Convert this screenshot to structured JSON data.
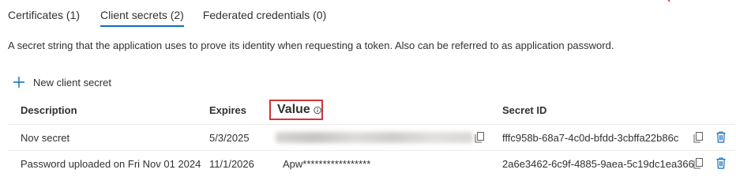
{
  "tabs": [
    {
      "label": "Certificates (1)",
      "active": false
    },
    {
      "label": "Client secrets (2)",
      "active": true
    },
    {
      "label": "Federated credentials (0)",
      "active": false
    }
  ],
  "description": "A secret string that the application uses to prove its identity when requesting a token. Also can be referred to as application password.",
  "new_secret_label": "New client secret",
  "table": {
    "headers": {
      "description": "Description",
      "expires": "Expires",
      "value": "Value",
      "secret_id": "Secret ID"
    },
    "rows": [
      {
        "description": "Nov secret",
        "expires": "5/3/2025",
        "value": "",
        "secret_id": "fffc958b-68a7-4c0d-bfdd-3cbffa22b86c"
      },
      {
        "description": "Password uploaded on Fri Nov 01 2024",
        "expires": "11/1/2026",
        "value": "Apw*****************",
        "secret_id": "2a6e3462-6c9f-4885-9aea-5c19dc1ea366"
      }
    ]
  },
  "colors": {
    "accent": "#0f6cbd",
    "highlight_border": "#d13438",
    "text": "#323130",
    "row_border": "#edebe9"
  },
  "icons": {
    "add": "plus-icon",
    "info": "info-icon",
    "copy": "copy-icon",
    "delete": "trash-icon"
  }
}
